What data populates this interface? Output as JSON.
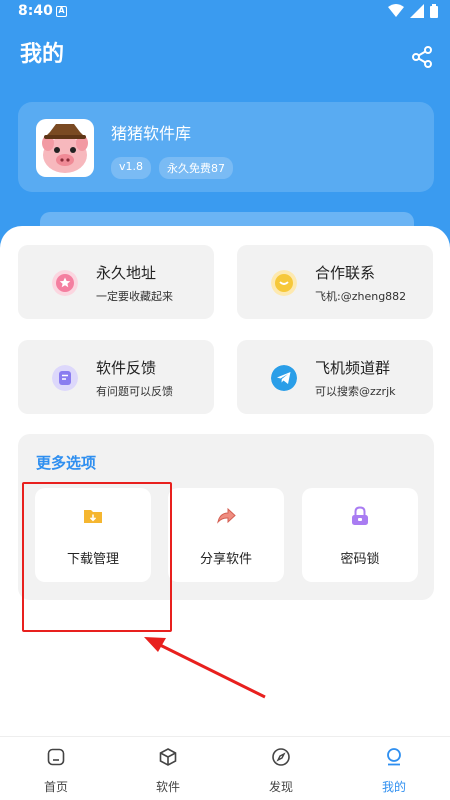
{
  "status_bar": {
    "time": "8:40",
    "notification_letter": "A"
  },
  "header": {
    "title": "我的"
  },
  "app_card": {
    "name": "猪猪软件库",
    "version": "v1.8",
    "tag": "永久免费87"
  },
  "features": [
    {
      "title": "永久地址",
      "subtitle": "一定要收藏起来",
      "icon": "star-icon",
      "color": "#f47fa0"
    },
    {
      "title": "合作联系",
      "subtitle": "飞机:@zheng882",
      "icon": "chat-bubble-icon",
      "color": "#f6c83a"
    },
    {
      "title": "软件反馈",
      "subtitle": "有问题可以反馈",
      "icon": "feedback-icon",
      "color": "#8a7df0"
    },
    {
      "title": "飞机频道群",
      "subtitle": "可以搜索@zzrjk",
      "icon": "telegram-icon",
      "color": "#2a9ee8"
    }
  ],
  "more": {
    "title": "更多选项",
    "options": [
      {
        "label": "下载管理",
        "icon": "download-folder-icon",
        "color": "#f5b630"
      },
      {
        "label": "分享软件",
        "icon": "share-arrow-icon",
        "color": "#ef8d80"
      },
      {
        "label": "密码锁",
        "icon": "lock-icon",
        "color": "#a97cf2"
      }
    ]
  },
  "bottom_nav": [
    {
      "label": "首页",
      "icon": "home-icon",
      "active": false
    },
    {
      "label": "软件",
      "icon": "cube-icon",
      "active": false
    },
    {
      "label": "发现",
      "icon": "compass-icon",
      "active": false
    },
    {
      "label": "我的",
      "icon": "profile-icon",
      "active": true
    }
  ],
  "colors": {
    "primary": "#3a9bf0",
    "accent": "#2f8ff0",
    "annotation_red": "#e8201e"
  }
}
